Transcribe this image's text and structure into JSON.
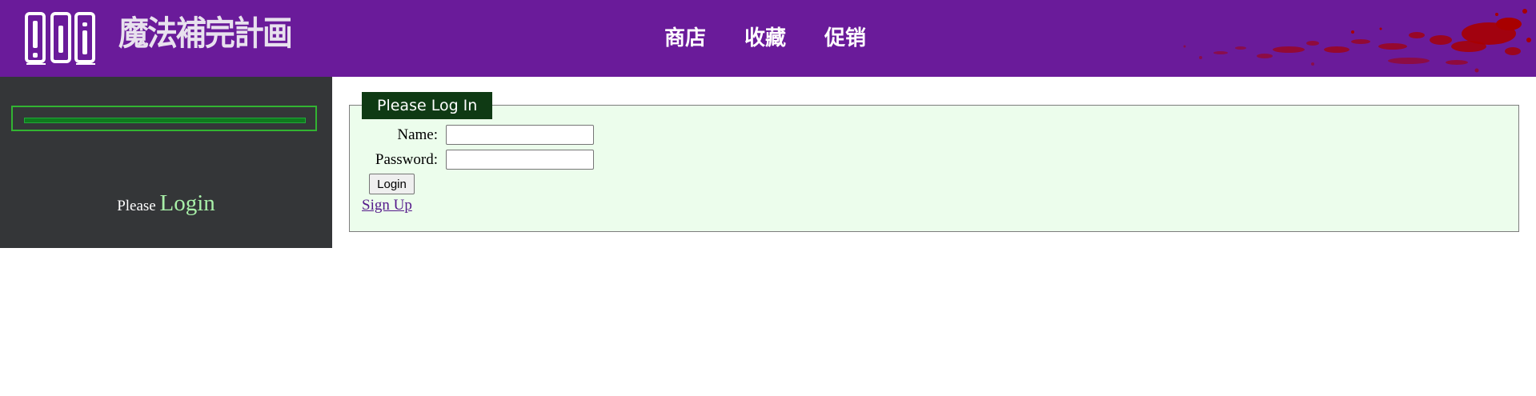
{
  "header": {
    "brand": "魔法補完計画",
    "nav": [
      {
        "label": "商店"
      },
      {
        "label": "收藏"
      },
      {
        "label": "促销"
      }
    ],
    "background_color": "#6a1b9a",
    "splatter_color": "#a80000",
    "logo_icon": "books-icon"
  },
  "sidebar": {
    "background_color": "#343638",
    "please_text": "Please",
    "login_link": "Login"
  },
  "login_form": {
    "legend": "Please Log In",
    "name_label": "Name:",
    "name_value": "",
    "password_label": "Password:",
    "password_value": "",
    "login_button": "Login",
    "signup_link": "Sign Up",
    "background_color": "#ecfdec",
    "legend_color": "#0f3a14"
  }
}
